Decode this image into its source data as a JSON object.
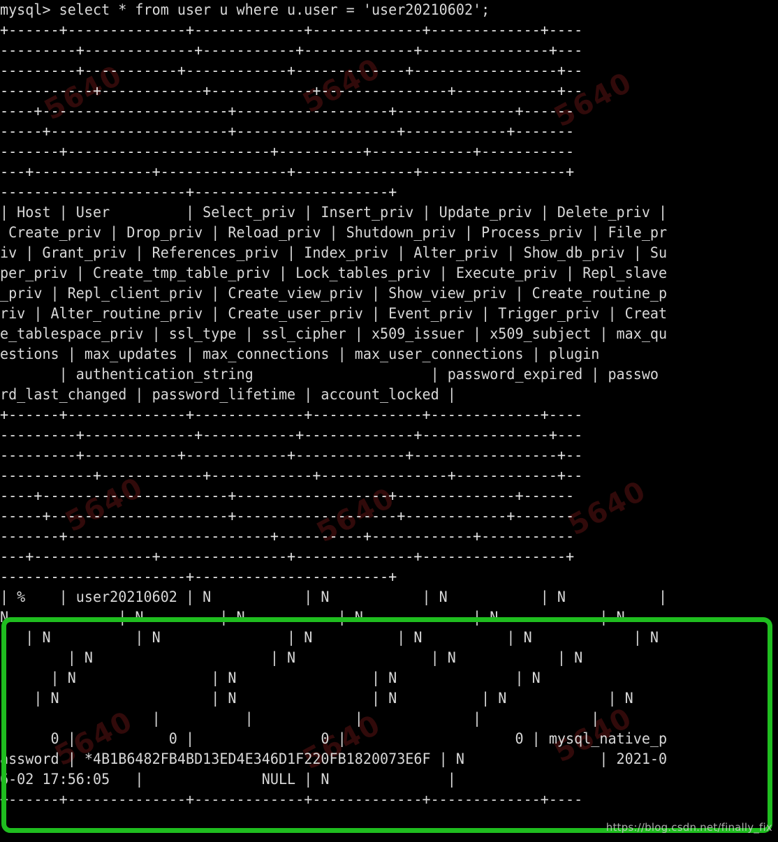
{
  "terminal": {
    "prompt": "mysql> ",
    "query": "select * from user u where u.user = 'user20210602';",
    "background_color": "#000000",
    "text_color": "#d8d8d8",
    "lines": [
      "mysql> select * from user u where u.user = 'user20210602';",
      "+------+--------------+-------------+-------------+-------------+----",
      "---------+-------------+-----------+-------------+---------------+---",
      "---------+-----------+------------+-------------+-----------------+--",
      "-----------+------------+------------+---------------+------------+--",
      "----+----------------------+------------------+--------------+------",
      "-----+---------------------+-------------------+------------+-------",
      "-------+------------------------+----------+------------+-----------",
      "---+--------------+---------------+--------------+-----------------+",
      "----------------------+-----------------------+",
      "| Host | User         | Select_priv | Insert_priv | Update_priv | Delete_priv |",
      " Create_priv | Drop_priv | Reload_priv | Shutdown_priv | Process_priv | File_pr",
      "iv | Grant_priv | References_priv | Index_priv | Alter_priv | Show_db_priv | Su",
      "per_priv | Create_tmp_table_priv | Lock_tables_priv | Execute_priv | Repl_slave",
      "_priv | Repl_client_priv | Create_view_priv | Show_view_priv | Create_routine_p",
      "riv | Alter_routine_priv | Create_user_priv | Event_priv | Trigger_priv | Creat",
      "e_tablespace_priv | ssl_type | ssl_cipher | x509_issuer | x509_subject | max_qu",
      "estions | max_updates | max_connections | max_user_connections | plugin",
      "       | authentication_string                     | password_expired | passwo",
      "rd_last_changed | password_lifetime | account_locked |",
      "+------+--------------+-------------+-------------+-------------+----",
      "---------+-------------+-----------+-------------+---------------+---",
      "---------+-----------+------------+-------------+-----------------+--",
      "-----------+------------+------------+---------------+------------+--",
      "----+----------------------+------------------+--------------+------",
      "-----+---------------------+-------------------+------------+-------",
      "-------+------------------------+----------+------------+-----------",
      "---+--------------+---------------+--------------+-----------------+",
      "----------------------+-----------------------+",
      "| %    | user20210602 | N           | N           | N           | N           |",
      "N             | N         | N           | N             | N            | N",
      "   | N          | N               | N          | N          | N            | N",
      "        | N                     | N                | N            | N",
      "      | N                | N                | N              | N",
      "    | N                  | N                | N          | N            | N",
      "                  |          |            |             |             |",
      "      0 |           0 |               0 |                    0 | mysql_native_p",
      "assword | *4B1B6482FB4BD13ED4E346D1F220FB1820073E6F | N                | 2021-0",
      "6-02 17:56:05   |              NULL | N              |",
      "+------+--------------+-------------+-------------+-------------+----"
    ],
    "separator_line_indices": [
      1,
      2,
      3,
      4,
      5,
      6,
      7,
      8,
      9,
      20,
      21,
      22,
      23,
      24,
      25,
      26,
      27,
      28,
      40
    ]
  },
  "result_row": {
    "Host": "%",
    "User": "user20210602",
    "Select_priv": "N",
    "Insert_priv": "N",
    "Update_priv": "N",
    "Delete_priv": "N",
    "Create_priv": "N",
    "Drop_priv": "N",
    "Reload_priv": "N",
    "Shutdown_priv": "N",
    "Process_priv": "N",
    "File_priv": "N",
    "Grant_priv": "N",
    "References_priv": "N",
    "Index_priv": "N",
    "Alter_priv": "N",
    "Show_db_priv": "N",
    "Super_priv": "N",
    "Create_tmp_table_priv": "N",
    "Lock_tables_priv": "N",
    "Execute_priv": "N",
    "Repl_slave_priv": "N",
    "Repl_client_priv": "N",
    "Create_view_priv": "N",
    "Show_view_priv": "N",
    "Create_routine_priv": "N",
    "Alter_routine_priv": "N",
    "Create_user_priv": "N",
    "Event_priv": "N",
    "Trigger_priv": "N",
    "Create_tablespace_priv": "N",
    "ssl_type": "",
    "ssl_cipher": "",
    "x509_issuer": "",
    "x509_subject": "",
    "max_questions": "0",
    "max_updates": "0",
    "max_connections": "0",
    "max_user_connections": "0",
    "plugin": "mysql_native_password",
    "authentication_string": "*4B1B6482FB4BD13ED4E346D1F220FB1820073E6F",
    "password_expired": "N",
    "password_last_changed": "2021-06-02 17:56:05",
    "password_lifetime": "NULL",
    "account_locked": "N"
  },
  "columns": [
    "Host",
    "User",
    "Select_priv",
    "Insert_priv",
    "Update_priv",
    "Delete_priv",
    "Create_priv",
    "Drop_priv",
    "Reload_priv",
    "Shutdown_priv",
    "Process_priv",
    "File_priv",
    "Grant_priv",
    "References_priv",
    "Index_priv",
    "Alter_priv",
    "Show_db_priv",
    "Super_priv",
    "Create_tmp_table_priv",
    "Lock_tables_priv",
    "Execute_priv",
    "Repl_slave_priv",
    "Repl_client_priv",
    "Create_view_priv",
    "Show_view_priv",
    "Create_routine_priv",
    "Alter_routine_priv",
    "Create_user_priv",
    "Event_priv",
    "Trigger_priv",
    "Create_tablespace_priv",
    "ssl_type",
    "ssl_cipher",
    "x509_issuer",
    "x509_subject",
    "max_questions",
    "max_updates",
    "max_connections",
    "max_user_connections",
    "plugin",
    "authentication_string",
    "password_expired",
    "password_last_changed",
    "password_lifetime",
    "account_locked"
  ],
  "annotation": {
    "highlight_color": "#1fbd1f",
    "highlight_border_width": "7px",
    "description": "green rounded rectangle around result row"
  },
  "watermark": {
    "blog_url": "https://blog.csdn.net/finally_fix",
    "background_marks": [
      "5640",
      "5640",
      "5640",
      "5640",
      "5640",
      "5640",
      "5640",
      "5640",
      "5640"
    ]
  }
}
